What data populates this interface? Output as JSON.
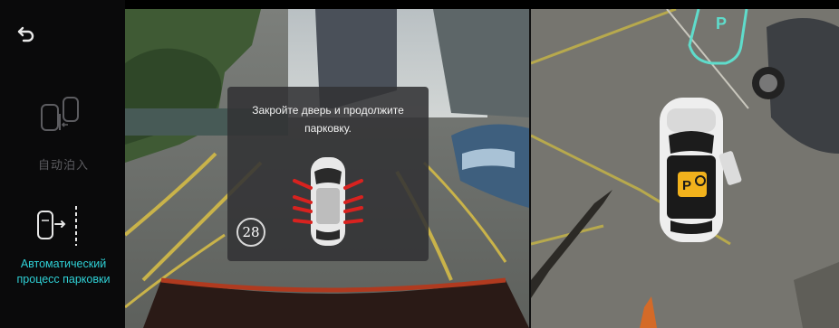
{
  "sidebar": {
    "back_icon": "back-arrow-icon",
    "modes": [
      {
        "label": "自动泊入",
        "icon": "parking-in-icon",
        "active": false
      },
      {
        "label": "Автоматический процесс парковки",
        "icon": "parking-out-icon",
        "active": true
      }
    ]
  },
  "popup": {
    "message": "Закройте дверь и продолжите парковку.",
    "countdown": "28",
    "car_icon": "car-doors-open-icon"
  },
  "topdown": {
    "parking_sign": "P",
    "car_icon": "ego-car-topview-icon",
    "overlay_icon": "parking-assist-icon"
  },
  "colors": {
    "accent": "#2fd1d6",
    "warning": "#d8221f",
    "overlay_yellow": "#f2b21c"
  }
}
